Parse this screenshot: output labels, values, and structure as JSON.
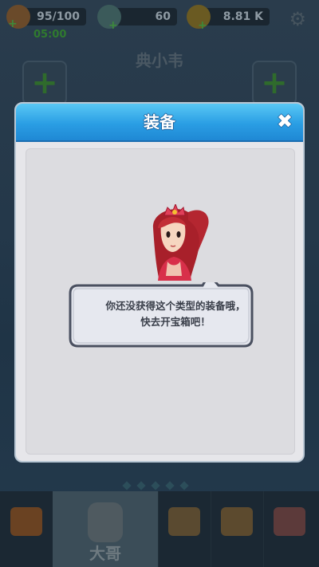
{
  "status_bar": {
    "energy": "95/100",
    "energy_timer": "05:00",
    "gems": "60",
    "gold": "8.81 K"
  },
  "hero": {
    "name": "典小韦"
  },
  "modal": {
    "title": "装备",
    "close_symbol": "✖",
    "message_line1": "你还没获得这个类型的装备哦，",
    "message_line2": "快去开宝箱吧！"
  },
  "bottom_nav": {
    "items": [
      {
        "icon": "treasure-chest-icon"
      },
      {
        "icon": "hero-armor-icon",
        "label": "大哥"
      },
      {
        "icon": "forge-icon"
      },
      {
        "icon": "tent-icon"
      },
      {
        "icon": "skill-book-icon"
      }
    ]
  },
  "colors": {
    "header_blue": "#2a9ee4",
    "panel_gray": "#dcdce0",
    "text_dark": "#3a3f4a"
  }
}
